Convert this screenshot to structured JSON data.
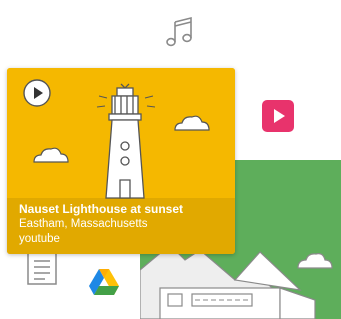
{
  "card": {
    "title": "Nauset Lighthouse at sunset",
    "subtitle": "Eastham, Massachusetts",
    "source": "youtube"
  },
  "colors": {
    "card_bg": "#F5B800",
    "accent_pink": "#E8336C",
    "green_tile": "#5EAE5B",
    "doodle_grey": "#8A8A8A"
  },
  "icons": [
    "music-note-icon",
    "youtube-play-icon",
    "play-button-icon",
    "document-icon",
    "google-drive-icon",
    "cloud-icon",
    "lighthouse-illustration",
    "mountain-illustration"
  ]
}
